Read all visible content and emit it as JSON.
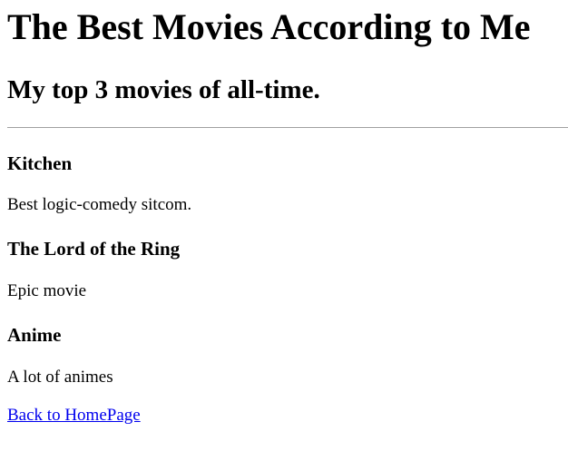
{
  "page": {
    "title": "The Best Movies According to Me",
    "subtitle": "My top 3 movies of all-time."
  },
  "movies": [
    {
      "name": "Kitchen",
      "description": "Best logic-comedy sitcom."
    },
    {
      "name": "The Lord of the Ring",
      "description": "Epic movie"
    },
    {
      "name": "Anime",
      "description": "A lot of animes"
    }
  ],
  "links": {
    "back_label": "Back to HomePage"
  },
  "colors": {
    "link": "#0000ee",
    "divider": "#a0a0a0",
    "text": "#000000",
    "background": "#ffffff"
  }
}
